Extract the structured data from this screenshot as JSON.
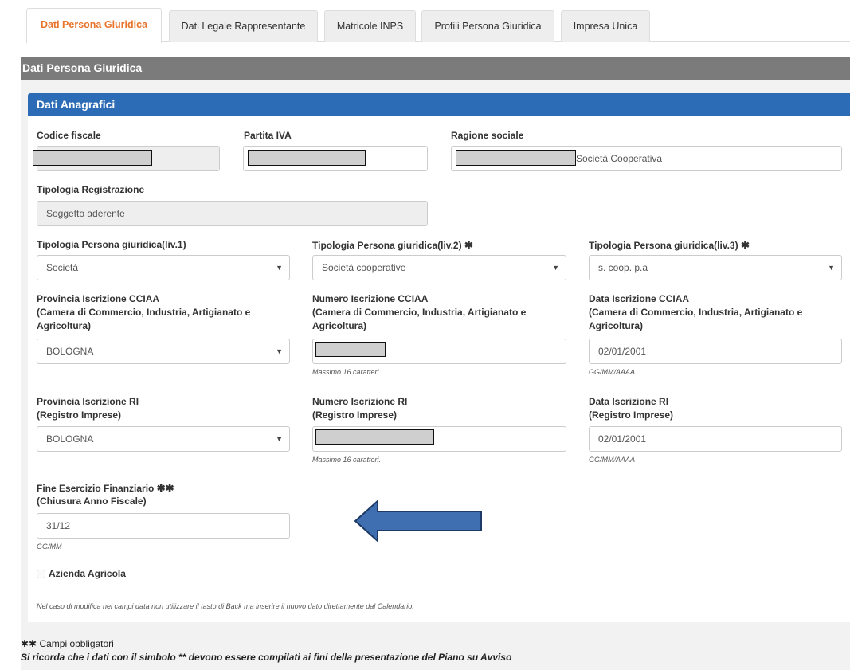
{
  "tabs": [
    {
      "label": "Dati Persona Giuridica",
      "active": true
    },
    {
      "label": "Dati Legale Rappresentante",
      "active": false
    },
    {
      "label": "Matricole INPS",
      "active": false
    },
    {
      "label": "Profili Persona Giuridica",
      "active": false
    },
    {
      "label": "Impresa Unica",
      "active": false
    }
  ],
  "section_title": "Dati Persona Giuridica",
  "subsection_title": "Dati Anagrafici",
  "codice_fiscale": {
    "label": "Codice fiscale"
  },
  "partita_iva": {
    "label": "Partita IVA"
  },
  "ragione_sociale": {
    "label": "Ragione sociale",
    "value_suffix": "Società Cooperativa"
  },
  "tipologia_registrazione": {
    "label": "Tipologia Registrazione",
    "value": "Soggetto aderente"
  },
  "tipologia_liv1": {
    "label": "Tipologia Persona giuridica(liv.1)",
    "value": "Società"
  },
  "tipologia_liv2": {
    "label": "Tipologia Persona giuridica(liv.2)",
    "required_mark": "✱",
    "value": "Società cooperative"
  },
  "tipologia_liv3": {
    "label": "Tipologia Persona giuridica(liv.3)",
    "required_mark": "✱",
    "value": "s. coop. p.a"
  },
  "provincia_cciaa": {
    "label_line1": "Provincia Iscrizione CCIAA",
    "label_line2": "(Camera di Commercio, Industria, Artigianato e",
    "label_line3": "Agricoltura)",
    "value": "BOLOGNA"
  },
  "numero_cciaa": {
    "label_line1": "Numero Iscrizione CCIAA",
    "label_line2": "(Camera di Commercio, Industria, Artigianato e",
    "label_line3": "Agricoltura)",
    "help": "Massimo 16 caratteri."
  },
  "data_cciaa": {
    "label_line1": "Data Iscrizione CCIAA",
    "label_line2": "(Camera di Commercio, Industria, Artigianato e",
    "label_line3": "Agricoltura)",
    "value": "02/01/2001",
    "help": "GG/MM/AAAA"
  },
  "provincia_ri": {
    "label_line1": "Provincia Iscrizione RI",
    "label_line2": "(Registro Imprese)",
    "value": "BOLOGNA"
  },
  "numero_ri": {
    "label_line1": "Numero Iscrizione RI",
    "label_line2": "(Registro Imprese)",
    "help": "Massimo 16 caratteri."
  },
  "data_ri": {
    "label_line1": "Data Iscrizione RI",
    "label_line2": "(Registro Imprese)",
    "value": "02/01/2001",
    "help": "GG/MM/AAAA"
  },
  "fine_esercizio": {
    "label_line1": "Fine Esercizio Finanziario",
    "required_mark": "✱✱",
    "label_line2": "(Chiusura Anno Fiscale)",
    "value": "31/12",
    "help": "GG/MM"
  },
  "azienda_agricola": {
    "label": "Azienda Agricola"
  },
  "date_note": "Nel caso di modifica nei campi data non utilizzare il tasto di Back ma inserire il nuovo dato direttamente dal Calendario.",
  "footer": {
    "required_mark": "✱✱",
    "required_label": "Campi obbligatori",
    "notice": "Si ricorda che i dati con il simbolo ** devono essere compilati ai fini della presentazione del Piano su Avviso"
  },
  "colors": {
    "active_tab": "#e8742c",
    "blue_header": "#2c6bb5",
    "grey_header": "#7b7b7b",
    "arrow": "#3f6fb0"
  }
}
